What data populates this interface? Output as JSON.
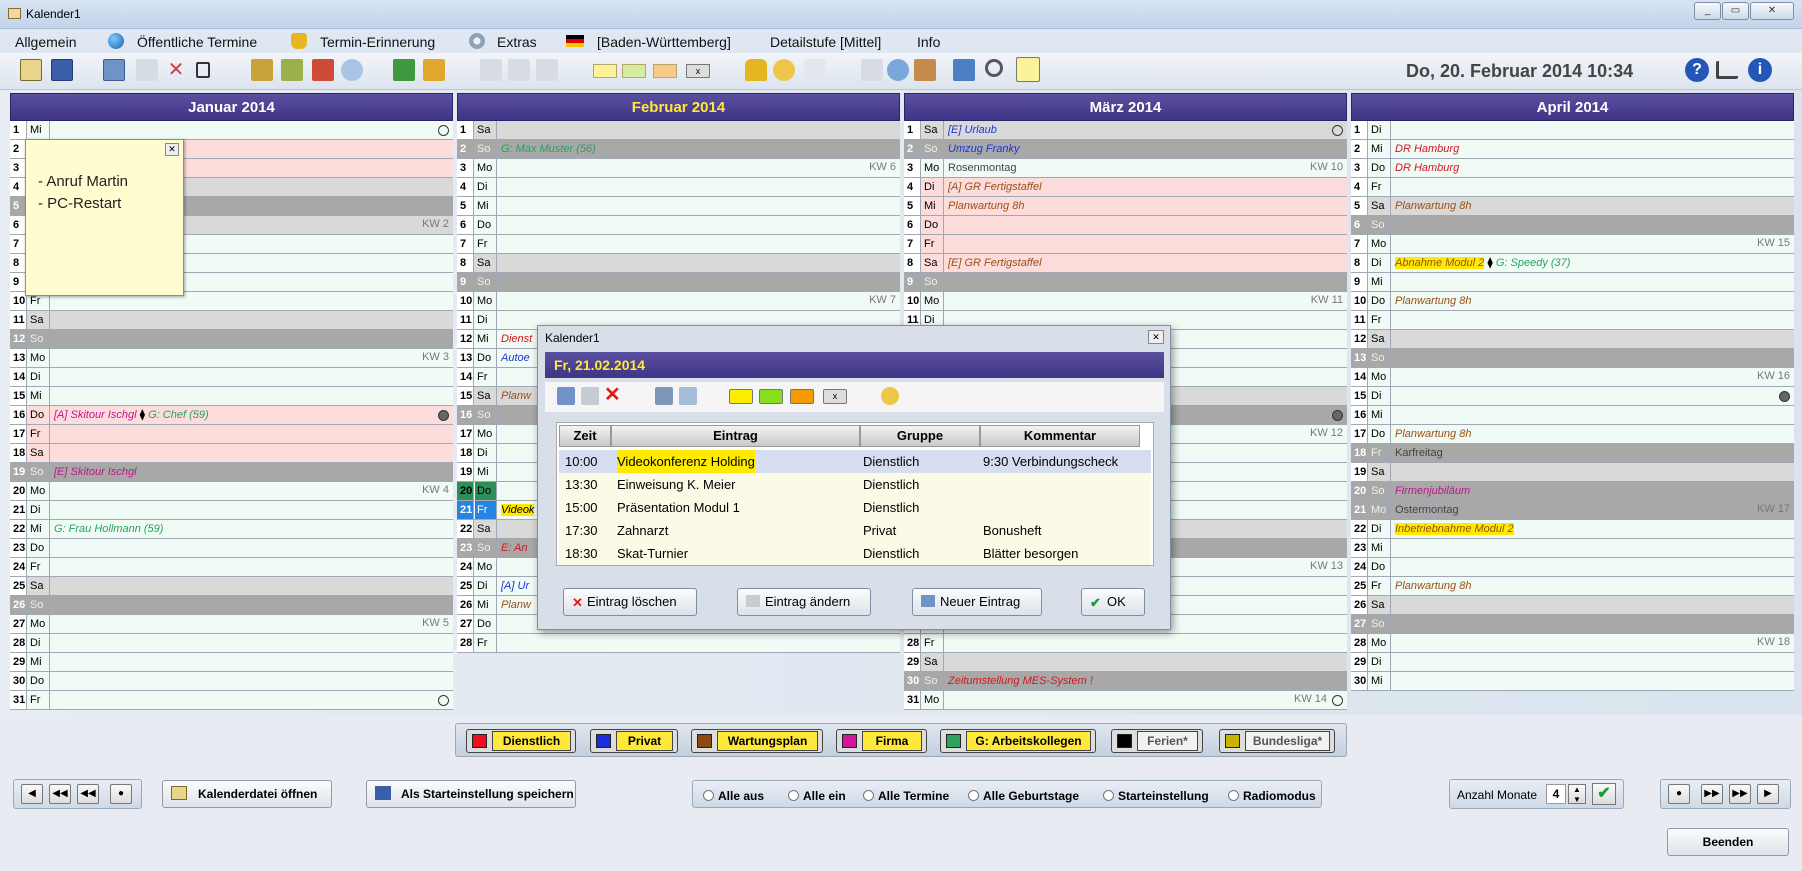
{
  "window": {
    "title": "Kalender1"
  },
  "menu": [
    {
      "label": "Allgemein"
    },
    {
      "label": "Öffentliche Termine",
      "icon": "globe-icon"
    },
    {
      "label": "Termin-Erinnerung",
      "icon": "bell-icon"
    },
    {
      "label": "Extras",
      "icon": "gear-icon"
    },
    {
      "label": "[Baden-Württemberg]",
      "icon": "german-flag-icon"
    },
    {
      "label": "Detailstufe [Mittel]"
    },
    {
      "label": "Info"
    }
  ],
  "header_datetime": "Do, 20. Februar 2014  10:34",
  "months": [
    {
      "title": "Januar 2014",
      "current": false,
      "days": [
        {
          "n": "1",
          "d": "Mi",
          "cls": "",
          "t": "",
          "kw": "",
          "dot": "hollow"
        },
        {
          "n": "2",
          "d": "Do",
          "cls": "vac",
          "t": "",
          "kw": ""
        },
        {
          "n": "3",
          "d": "Fr",
          "cls": "vac",
          "t": "",
          "kw": ""
        },
        {
          "n": "4",
          "d": "Sa",
          "cls": "sat",
          "t": "",
          "kw": ""
        },
        {
          "n": "5",
          "d": "So",
          "cls": "sun",
          "t": "",
          "kw": ""
        },
        {
          "n": "6",
          "d": "Mo",
          "cls": "sat",
          "t": "",
          "kw": "KW 2"
        },
        {
          "n": "7",
          "d": "Di",
          "cls": "",
          "t": "",
          "kw": ""
        },
        {
          "n": "8",
          "d": "Mi",
          "cls": "",
          "t": "",
          "kw": ""
        },
        {
          "n": "9",
          "d": "Do",
          "cls": "",
          "t": "",
          "kw": ""
        },
        {
          "n": "10",
          "d": "Fr",
          "cls": "",
          "t": "",
          "kw": ""
        },
        {
          "n": "11",
          "d": "Sa",
          "cls": "sat",
          "t": "",
          "kw": ""
        },
        {
          "n": "12",
          "d": "So",
          "cls": "sun",
          "t": "",
          "kw": ""
        },
        {
          "n": "13",
          "d": "Mo",
          "cls": "",
          "t": "",
          "kw": "KW 3"
        },
        {
          "n": "14",
          "d": "Di",
          "cls": "",
          "t": "",
          "kw": ""
        },
        {
          "n": "15",
          "d": "Mi",
          "cls": "",
          "t": "",
          "kw": ""
        },
        {
          "n": "16",
          "d": "Do",
          "cls": "vac",
          "t": "[A] Skitour Ischgl",
          "c": "c-mag",
          "t2": "G: Chef (59)",
          "c2": "c-green",
          "kw": "",
          "dot": "filled"
        },
        {
          "n": "17",
          "d": "Fr",
          "cls": "vac",
          "t": "",
          "kw": ""
        },
        {
          "n": "18",
          "d": "Sa",
          "cls": "vac",
          "t": "",
          "kw": ""
        },
        {
          "n": "19",
          "d": "So",
          "cls": "sun",
          "t": "[E] Skitour Ischgl",
          "c": "c-mag",
          "kw": ""
        },
        {
          "n": "20",
          "d": "Mo",
          "cls": "",
          "t": "",
          "kw": "KW 4"
        },
        {
          "n": "21",
          "d": "Di",
          "cls": "",
          "t": "",
          "kw": ""
        },
        {
          "n": "22",
          "d": "Mi",
          "cls": "",
          "t": "G: Frau Hollmann (59)",
          "c": "c-green",
          "kw": ""
        },
        {
          "n": "23",
          "d": "Do",
          "cls": "",
          "t": "",
          "kw": ""
        },
        {
          "n": "24",
          "d": "Fr",
          "cls": "",
          "t": "",
          "kw": ""
        },
        {
          "n": "25",
          "d": "Sa",
          "cls": "sat",
          "t": "",
          "kw": ""
        },
        {
          "n": "26",
          "d": "So",
          "cls": "sun",
          "t": "",
          "kw": ""
        },
        {
          "n": "27",
          "d": "Mo",
          "cls": "",
          "t": "",
          "kw": "KW 5"
        },
        {
          "n": "28",
          "d": "Di",
          "cls": "",
          "t": "",
          "kw": ""
        },
        {
          "n": "29",
          "d": "Mi",
          "cls": "",
          "t": "",
          "kw": ""
        },
        {
          "n": "30",
          "d": "Do",
          "cls": "",
          "t": "",
          "kw": ""
        },
        {
          "n": "31",
          "d": "Fr",
          "cls": "",
          "t": "",
          "kw": "",
          "dot": "hollow"
        }
      ]
    },
    {
      "title": "Februar 2014",
      "current": true,
      "days": [
        {
          "n": "1",
          "d": "Sa",
          "cls": "sat",
          "t": "",
          "kw": ""
        },
        {
          "n": "2",
          "d": "So",
          "cls": "sun",
          "t": "G: Max Muster (56)",
          "c": "c-green",
          "kw": ""
        },
        {
          "n": "3",
          "d": "Mo",
          "cls": "",
          "t": "",
          "kw": "KW 6"
        },
        {
          "n": "4",
          "d": "Di",
          "cls": "",
          "t": "",
          "kw": ""
        },
        {
          "n": "5",
          "d": "Mi",
          "cls": "",
          "t": "",
          "kw": ""
        },
        {
          "n": "6",
          "d": "Do",
          "cls": "",
          "t": "",
          "kw": ""
        },
        {
          "n": "7",
          "d": "Fr",
          "cls": "",
          "t": "",
          "kw": ""
        },
        {
          "n": "8",
          "d": "Sa",
          "cls": "sat",
          "t": "",
          "kw": ""
        },
        {
          "n": "9",
          "d": "So",
          "cls": "sun",
          "t": "",
          "kw": ""
        },
        {
          "n": "10",
          "d": "Mo",
          "cls": "",
          "t": "",
          "kw": "KW 7"
        },
        {
          "n": "11",
          "d": "Di",
          "cls": "",
          "t": "",
          "kw": ""
        },
        {
          "n": "12",
          "d": "Mi",
          "cls": "",
          "t": "Dienst",
          "c": "c-red",
          "kw": ""
        },
        {
          "n": "13",
          "d": "Do",
          "cls": "",
          "t": "Autoe",
          "c": "c-blue",
          "kw": ""
        },
        {
          "n": "14",
          "d": "Fr",
          "cls": "",
          "t": "",
          "kw": ""
        },
        {
          "n": "15",
          "d": "Sa",
          "cls": "sat",
          "t": "Planw",
          "c": "c-brown",
          "kw": ""
        },
        {
          "n": "16",
          "d": "So",
          "cls": "sun",
          "t": "",
          "kw": ""
        },
        {
          "n": "17",
          "d": "Mo",
          "cls": "",
          "t": "",
          "kw": ""
        },
        {
          "n": "18",
          "d": "Di",
          "cls": "",
          "t": "",
          "kw": ""
        },
        {
          "n": "19",
          "d": "Mi",
          "cls": "",
          "t": "",
          "kw": ""
        },
        {
          "n": "20",
          "d": "Do",
          "cls": "today",
          "t": "",
          "kw": ""
        },
        {
          "n": "21",
          "d": "Fr",
          "cls": "sel",
          "t": "Videok",
          "c": "hl-yellow",
          "kw": ""
        },
        {
          "n": "22",
          "d": "Sa",
          "cls": "sat",
          "t": "",
          "kw": ""
        },
        {
          "n": "23",
          "d": "So",
          "cls": "sun",
          "t": "E: An",
          "c": "c-red",
          "kw": ""
        },
        {
          "n": "24",
          "d": "Mo",
          "cls": "",
          "t": "",
          "kw": ""
        },
        {
          "n": "25",
          "d": "Di",
          "cls": "",
          "t": "[A] Ur",
          "c": "c-blue",
          "kw": ""
        },
        {
          "n": "26",
          "d": "Mi",
          "cls": "",
          "t": "Planw",
          "c": "c-brown",
          "kw": ""
        },
        {
          "n": "27",
          "d": "Do",
          "cls": "",
          "t": "",
          "kw": ""
        },
        {
          "n": "28",
          "d": "Fr",
          "cls": "",
          "t": "",
          "kw": ""
        }
      ]
    },
    {
      "title": "März 2014",
      "current": false,
      "days": [
        {
          "n": "1",
          "d": "Sa",
          "cls": "sat",
          "t": "[E] Urlaub",
          "c": "c-blue",
          "kw": "",
          "dot": "hollow"
        },
        {
          "n": "2",
          "d": "So",
          "cls": "sun",
          "t": "Umzug Franky",
          "c": "c-blue",
          "kw": ""
        },
        {
          "n": "3",
          "d": "Mo",
          "cls": "",
          "t": "Rosenmontag",
          "c": "c-gray",
          "kw": "KW 10"
        },
        {
          "n": "4",
          "d": "Di",
          "cls": "vac",
          "t": "[A] GR Fertigstaffel",
          "c": "c-brown",
          "kw": ""
        },
        {
          "n": "5",
          "d": "Mi",
          "cls": "vac",
          "t": "Planwartung 8h",
          "c": "c-brown",
          "kw": ""
        },
        {
          "n": "6",
          "d": "Do",
          "cls": "vac",
          "t": "",
          "kw": ""
        },
        {
          "n": "7",
          "d": "Fr",
          "cls": "vac",
          "t": "",
          "kw": ""
        },
        {
          "n": "8",
          "d": "Sa",
          "cls": "vac",
          "t": "[E] GR Fertigstaffel",
          "c": "c-brown",
          "kw": ""
        },
        {
          "n": "9",
          "d": "So",
          "cls": "sun",
          "t": "",
          "kw": ""
        },
        {
          "n": "10",
          "d": "Mo",
          "cls": "",
          "t": "",
          "kw": "KW 11"
        },
        {
          "n": "11",
          "d": "Di",
          "cls": "",
          "t": "",
          "kw": ""
        },
        {
          "n": "12",
          "d": "Mi",
          "cls": "",
          "t": "",
          "kw": ""
        },
        {
          "n": "13",
          "d": "Do",
          "cls": "",
          "t": "",
          "kw": ""
        },
        {
          "n": "14",
          "d": "Fr",
          "cls": "",
          "t": "",
          "kw": ""
        },
        {
          "n": "15",
          "d": "Sa",
          "cls": "sat",
          "t": "",
          "kw": ""
        },
        {
          "n": "16",
          "d": "So",
          "cls": "sun",
          "t": "",
          "kw": "",
          "dot": "filled"
        },
        {
          "n": "17",
          "d": "Mo",
          "cls": "",
          "t": "",
          "kw": "KW 12"
        },
        {
          "n": "18",
          "d": "Di",
          "cls": "",
          "t": "",
          "kw": ""
        },
        {
          "n": "19",
          "d": "Mi",
          "cls": "",
          "t": "",
          "kw": ""
        },
        {
          "n": "20",
          "d": "Do",
          "cls": "",
          "t": "",
          "kw": ""
        },
        {
          "n": "21",
          "d": "Fr",
          "cls": "",
          "t": "",
          "kw": ""
        },
        {
          "n": "22",
          "d": "Sa",
          "cls": "sat",
          "t": "",
          "kw": ""
        },
        {
          "n": "23",
          "d": "So",
          "cls": "sun",
          "t": "",
          "kw": ""
        },
        {
          "n": "24",
          "d": "Mo",
          "cls": "",
          "t": "",
          "kw": "KW 13"
        },
        {
          "n": "25",
          "d": "Di",
          "cls": "",
          "t": "",
          "kw": ""
        },
        {
          "n": "26",
          "d": "Mi",
          "cls": "",
          "t": "",
          "kw": ""
        },
        {
          "n": "27",
          "d": "Do",
          "cls": "",
          "t": "",
          "kw": ""
        },
        {
          "n": "28",
          "d": "Fr",
          "cls": "",
          "t": "",
          "kw": ""
        },
        {
          "n": "29",
          "d": "Sa",
          "cls": "sat",
          "t": "",
          "kw": ""
        },
        {
          "n": "30",
          "d": "So",
          "cls": "sun",
          "t": "Zeitumstellung MES-System !",
          "c": "c-red",
          "kw": ""
        },
        {
          "n": "31",
          "d": "Mo",
          "cls": "",
          "t": "",
          "kw": "KW 14",
          "dot": "hollow"
        }
      ]
    },
    {
      "title": "April 2014",
      "current": false,
      "days": [
        {
          "n": "1",
          "d": "Di",
          "cls": "",
          "t": "",
          "kw": ""
        },
        {
          "n": "2",
          "d": "Mi",
          "cls": "",
          "t": "DR Hamburg",
          "c": "c-red",
          "kw": ""
        },
        {
          "n": "3",
          "d": "Do",
          "cls": "",
          "t": "DR Hamburg",
          "c": "c-red",
          "kw": ""
        },
        {
          "n": "4",
          "d": "Fr",
          "cls": "",
          "t": "",
          "kw": ""
        },
        {
          "n": "5",
          "d": "Sa",
          "cls": "sat",
          "t": "Planwartung 8h",
          "c": "c-brown",
          "kw": ""
        },
        {
          "n": "6",
          "d": "So",
          "cls": "sun",
          "t": "",
          "kw": ""
        },
        {
          "n": "7",
          "d": "Mo",
          "cls": "",
          "t": "",
          "kw": "KW 15"
        },
        {
          "n": "8",
          "d": "Di",
          "cls": "",
          "t": "Abnahme Modul 2",
          "c": "hl-yellow c-brown",
          "t2": "G: Speedy (37)",
          "c2": "c-green",
          "kw": ""
        },
        {
          "n": "9",
          "d": "Mi",
          "cls": "",
          "t": "",
          "kw": ""
        },
        {
          "n": "10",
          "d": "Do",
          "cls": "",
          "t": "Planwartung 8h",
          "c": "c-brown",
          "kw": ""
        },
        {
          "n": "11",
          "d": "Fr",
          "cls": "",
          "t": "",
          "kw": ""
        },
        {
          "n": "12",
          "d": "Sa",
          "cls": "sat",
          "t": "",
          "kw": ""
        },
        {
          "n": "13",
          "d": "So",
          "cls": "sun",
          "t": "",
          "kw": ""
        },
        {
          "n": "14",
          "d": "Mo",
          "cls": "",
          "t": "",
          "kw": "KW 16"
        },
        {
          "n": "15",
          "d": "Di",
          "cls": "",
          "t": "",
          "kw": "",
          "dot": "filled"
        },
        {
          "n": "16",
          "d": "Mi",
          "cls": "",
          "t": "",
          "kw": ""
        },
        {
          "n": "17",
          "d": "Do",
          "cls": "",
          "t": "Planwartung 8h",
          "c": "c-brown",
          "kw": ""
        },
        {
          "n": "18",
          "d": "Fr",
          "cls": "sun",
          "t": "Karfreitag",
          "c": "c-gray",
          "kw": ""
        },
        {
          "n": "19",
          "d": "Sa",
          "cls": "sat",
          "t": "",
          "kw": ""
        },
        {
          "n": "20",
          "d": "So",
          "cls": "sun",
          "t": "Firmenjubiläum",
          "c": "c-mag",
          "kw": ""
        },
        {
          "n": "21",
          "d": "Mo",
          "cls": "sun",
          "t": "Ostermontag",
          "c": "c-gray",
          "kw": "KW 17"
        },
        {
          "n": "22",
          "d": "Di",
          "cls": "",
          "t": "Inbetriebnahme Modul 2",
          "c": "hl-yellow c-brown",
          "kw": ""
        },
        {
          "n": "23",
          "d": "Mi",
          "cls": "",
          "t": "",
          "kw": ""
        },
        {
          "n": "24",
          "d": "Do",
          "cls": "",
          "t": "",
          "kw": ""
        },
        {
          "n": "25",
          "d": "Fr",
          "cls": "",
          "t": "Planwartung 8h",
          "c": "c-brown",
          "kw": ""
        },
        {
          "n": "26",
          "d": "Sa",
          "cls": "sat",
          "t": "",
          "kw": ""
        },
        {
          "n": "27",
          "d": "So",
          "cls": "sun",
          "t": "",
          "kw": ""
        },
        {
          "n": "28",
          "d": "Mo",
          "cls": "",
          "t": "",
          "kw": "KW 18"
        },
        {
          "n": "29",
          "d": "Di",
          "cls": "",
          "t": "",
          "kw": ""
        },
        {
          "n": "30",
          "d": "Mi",
          "cls": "",
          "t": "",
          "kw": ""
        }
      ]
    }
  ],
  "sticky_note": {
    "line1": "- Anruf Martin",
    "line2": "- PC-Restart"
  },
  "legend": [
    {
      "label": "Dienstlich",
      "color": "#e8101a",
      "bg": "#ffe83a"
    },
    {
      "label": "Privat",
      "color": "#1a2fd9",
      "bg": "#ffe83a"
    },
    {
      "label": "Wartungsplan",
      "color": "#8a4a14",
      "bg": "#ffe83a"
    },
    {
      "label": "Firma",
      "color": "#d4149a",
      "bg": "#ffe83a"
    },
    {
      "label": "G: Arbeitskollegen",
      "color": "#2da35f",
      "bg": "#ffe83a"
    },
    {
      "label": "Ferien*",
      "color": "#000000",
      "bg": "#f2f2f2"
    },
    {
      "label": "Bundesliga*",
      "color": "#c8b400",
      "bg": "#f2f2f2"
    }
  ],
  "bottom": {
    "open_button": "Kalenderdatei öffnen",
    "save_button": "Als Starteinstellung speichern",
    "radios": [
      "Alle aus",
      "Alle ein",
      "Alle Termine",
      "Alle Geburtstage",
      "Starteinstellung",
      "Radiomodus"
    ],
    "months_label": "Anzahl Monate",
    "months_value": "4",
    "exit_button": "Beenden"
  },
  "dialog": {
    "title": "Kalender1",
    "date": "Fr, 21.02.2014",
    "columns": [
      "Zeit",
      "Eintrag",
      "Gruppe",
      "Kommentar"
    ],
    "rows": [
      {
        "zeit": "10:00",
        "eintrag": "Videokonferenz Holding",
        "gruppe": "Dienstlich",
        "kommentar": "9:30 Verbindungscheck"
      },
      {
        "zeit": "13:30",
        "eintrag": "Einweisung K. Meier",
        "gruppe": "Dienstlich",
        "kommentar": ""
      },
      {
        "zeit": "15:00",
        "eintrag": "Präsentation Modul 1",
        "gruppe": "Dienstlich",
        "kommentar": ""
      },
      {
        "zeit": "17:30",
        "eintrag": "Zahnarzt",
        "gruppe": "Privat",
        "kommentar": "Bonusheft"
      },
      {
        "zeit": "18:30",
        "eintrag": "Skat-Turnier",
        "gruppe": "Dienstlich",
        "kommentar": "Blätter besorgen"
      }
    ],
    "delete_button": "Eintrag löschen",
    "edit_button": "Eintrag ändern",
    "new_button": "Neuer Eintrag",
    "ok_button": "OK"
  }
}
